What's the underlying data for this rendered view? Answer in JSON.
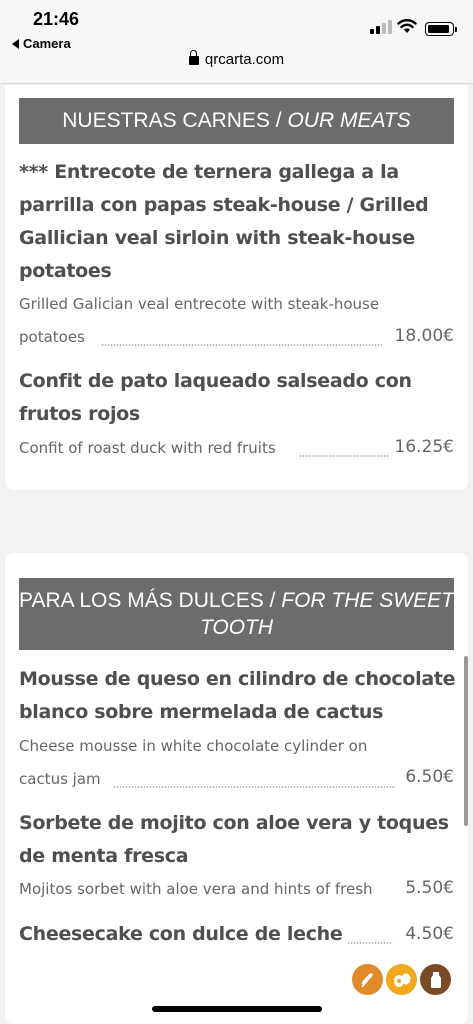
{
  "status_bar": {
    "time": "21:46",
    "back_label": "Camera",
    "url": "qrcarta.com"
  },
  "sections": [
    {
      "title": "NUESTRAS CARNES",
      "title_en": "OUR MEATS",
      "items": [
        {
          "name": "*** Entrecote de ternera gallega a la parrilla con papas steak-house / Grilled Gallician veal sirloin with steak-house potatoes",
          "desc_line1": "Grilled Galician veal entrecote with steak-house",
          "desc_line2": "potatoes",
          "price": "18.00€"
        },
        {
          "name": "Confit de pato laqueado salseado con frutos rojos",
          "desc_line1": "Confit of roast duck with red fruits",
          "price": "16.25€"
        }
      ]
    },
    {
      "title": "PARA LOS MÁS DULCES",
      "title_en": "FOR THE SWEET TOOTH",
      "items": [
        {
          "name": "Mousse de queso en cilindro de chocolate blanco sobre mermelada de cactus",
          "desc_line1": "Cheese mousse in white chocolate cylinder on",
          "desc_line2": "cactus jam",
          "price": "6.50€"
        },
        {
          "name": "Sorbete de mojito con aloe vera y toques de menta fresca",
          "desc_line1": "Mojitos sorbet with aloe vera and hints of fresh",
          "price": "5.50€"
        },
        {
          "name": "Cheesecake con dulce de leche",
          "price": "4.50€"
        }
      ]
    }
  ],
  "allergen_icons": [
    {
      "name": "gluten-icon",
      "color": "#e08a2c"
    },
    {
      "name": "egg-icon",
      "color": "#f0a81e"
    },
    {
      "name": "milk-icon",
      "color": "#7a4a26"
    }
  ]
}
